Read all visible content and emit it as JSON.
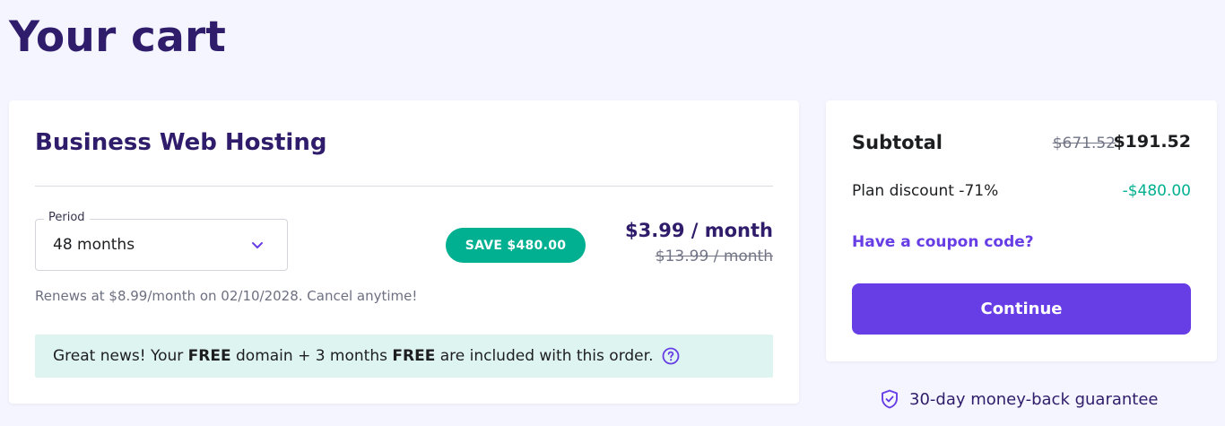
{
  "page": {
    "title": "Your cart"
  },
  "product": {
    "name": "Business Web Hosting",
    "period": {
      "label": "Period",
      "value": "48 months"
    },
    "save_badge": "SAVE $480.00",
    "price_now": "$3.99 / month",
    "price_old": "$13.99 / month",
    "renew_note": "Renews at $8.99/month on 02/10/2028. Cancel anytime!",
    "promo": {
      "part1": "Great news! Your ",
      "bold1": "FREE",
      "part2": " domain + 3 months ",
      "bold2": "FREE",
      "part3": " are included with this order."
    }
  },
  "summary": {
    "subtotal_label": "Subtotal",
    "subtotal_old": "$671.52",
    "subtotal_now": "$191.52",
    "discount_label": "Plan discount -71%",
    "discount_value": "-$480.00",
    "coupon_link": "Have a coupon code?",
    "continue_label": "Continue"
  },
  "guarantee": {
    "text": "30-day money-back guarantee"
  },
  "icons": {
    "chevron": "chevron-down-icon",
    "help": "help-circle-icon",
    "shield": "shield-check-icon"
  },
  "colors": {
    "brand_dark": "#2f1c6a",
    "primary": "#673de6",
    "success": "#00b090",
    "promo_bg": "#def4f0",
    "page_bg": "#f4f5ff"
  }
}
